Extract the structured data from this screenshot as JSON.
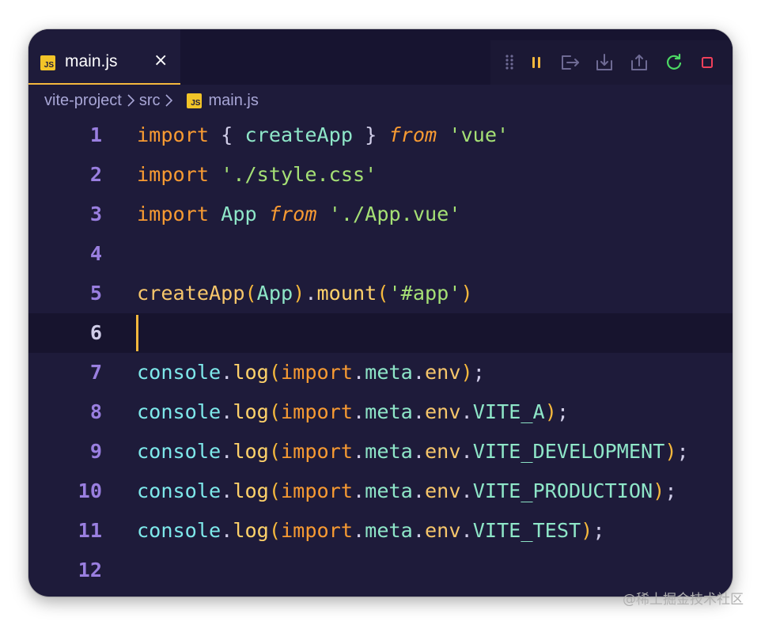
{
  "tab": {
    "badge": "JS",
    "label": "main.js",
    "close": "×"
  },
  "toolbar": {
    "buttons": [
      {
        "name": "drag-handle-icon"
      },
      {
        "name": "pause-icon",
        "color": "#f5b83d"
      },
      {
        "name": "step-over-icon"
      },
      {
        "name": "step-into-icon"
      },
      {
        "name": "step-out-icon"
      },
      {
        "name": "restart-icon",
        "color": "#4cd964"
      },
      {
        "name": "stop-icon",
        "color": "#f0405a"
      }
    ]
  },
  "breadcrumb": {
    "project": "vite-project",
    "folder": "src",
    "badge": "JS",
    "file": "main.js"
  },
  "editor": {
    "current_line": 6,
    "lines": [
      {
        "n": "1",
        "tokens": [
          [
            "kw",
            "import"
          ],
          [
            "punc",
            " { "
          ],
          [
            "cls",
            "createApp"
          ],
          [
            "punc",
            " } "
          ],
          [
            "it",
            "from"
          ],
          [
            "punc",
            " "
          ],
          [
            "str",
            "'vue'"
          ]
        ]
      },
      {
        "n": "2",
        "tokens": [
          [
            "kw",
            "import"
          ],
          [
            "punc",
            " "
          ],
          [
            "str",
            "'./style.css'"
          ]
        ]
      },
      {
        "n": "3",
        "tokens": [
          [
            "kw",
            "import"
          ],
          [
            "punc",
            " "
          ],
          [
            "cls",
            "App"
          ],
          [
            "punc",
            " "
          ],
          [
            "it",
            "from"
          ],
          [
            "punc",
            " "
          ],
          [
            "str",
            "'./App.vue'"
          ]
        ]
      },
      {
        "n": "4",
        "tokens": []
      },
      {
        "n": "5",
        "tokens": [
          [
            "fn",
            "createApp"
          ],
          [
            "paren",
            "("
          ],
          [
            "cls",
            "App"
          ],
          [
            "paren",
            ")"
          ],
          [
            "punc",
            "."
          ],
          [
            "method",
            "mount"
          ],
          [
            "paren",
            "("
          ],
          [
            "str",
            "'#app'"
          ],
          [
            "paren",
            ")"
          ]
        ]
      },
      {
        "n": "6",
        "tokens": []
      },
      {
        "n": "7",
        "tokens": [
          [
            "obj",
            "console"
          ],
          [
            "punc",
            "."
          ],
          [
            "method",
            "log"
          ],
          [
            "paren",
            "("
          ],
          [
            "kw",
            "import"
          ],
          [
            "punc",
            "."
          ],
          [
            "prop",
            "meta"
          ],
          [
            "punc",
            "."
          ],
          [
            "env",
            "env"
          ],
          [
            "paren",
            ")"
          ],
          [
            "punc",
            ";"
          ]
        ]
      },
      {
        "n": "8",
        "tokens": [
          [
            "obj",
            "console"
          ],
          [
            "punc",
            "."
          ],
          [
            "method",
            "log"
          ],
          [
            "paren",
            "("
          ],
          [
            "kw",
            "import"
          ],
          [
            "punc",
            "."
          ],
          [
            "prop",
            "meta"
          ],
          [
            "punc",
            "."
          ],
          [
            "env",
            "env"
          ],
          [
            "punc",
            "."
          ],
          [
            "var",
            "VITE_A"
          ],
          [
            "paren",
            ")"
          ],
          [
            "punc",
            ";"
          ]
        ]
      },
      {
        "n": "9",
        "tokens": [
          [
            "obj",
            "console"
          ],
          [
            "punc",
            "."
          ],
          [
            "method",
            "log"
          ],
          [
            "paren",
            "("
          ],
          [
            "kw",
            "import"
          ],
          [
            "punc",
            "."
          ],
          [
            "prop",
            "meta"
          ],
          [
            "punc",
            "."
          ],
          [
            "env",
            "env"
          ],
          [
            "punc",
            "."
          ],
          [
            "var",
            "VITE_DEVELOPMENT"
          ],
          [
            "paren",
            ")"
          ],
          [
            "punc",
            ";"
          ]
        ]
      },
      {
        "n": "10",
        "tokens": [
          [
            "obj",
            "console"
          ],
          [
            "punc",
            "."
          ],
          [
            "method",
            "log"
          ],
          [
            "paren",
            "("
          ],
          [
            "kw",
            "import"
          ],
          [
            "punc",
            "."
          ],
          [
            "prop",
            "meta"
          ],
          [
            "punc",
            "."
          ],
          [
            "env",
            "env"
          ],
          [
            "punc",
            "."
          ],
          [
            "var",
            "VITE_PRODUCTION"
          ],
          [
            "paren",
            ")"
          ],
          [
            "punc",
            ";"
          ]
        ]
      },
      {
        "n": "11",
        "tokens": [
          [
            "obj",
            "console"
          ],
          [
            "punc",
            "."
          ],
          [
            "method",
            "log"
          ],
          [
            "paren",
            "("
          ],
          [
            "kw",
            "import"
          ],
          [
            "punc",
            "."
          ],
          [
            "prop",
            "meta"
          ],
          [
            "punc",
            "."
          ],
          [
            "env",
            "env"
          ],
          [
            "punc",
            "."
          ],
          [
            "var",
            "VITE_TEST"
          ],
          [
            "paren",
            ")"
          ],
          [
            "punc",
            ";"
          ]
        ]
      },
      {
        "n": "12",
        "tokens": []
      }
    ]
  },
  "watermark": "@稀土掘金技术社区"
}
